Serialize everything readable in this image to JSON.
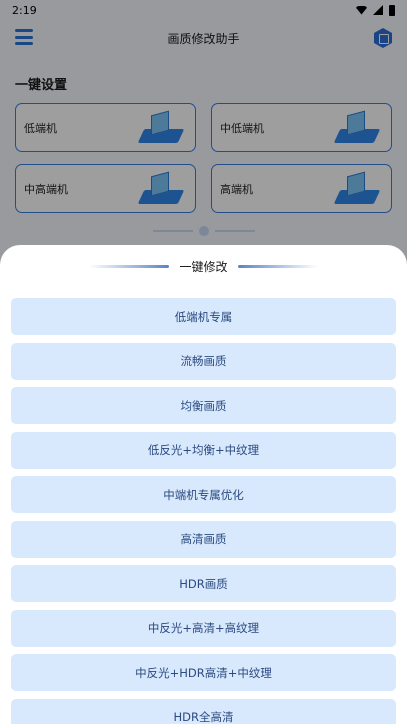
{
  "statusbar": {
    "time": "2:19"
  },
  "appbar": {
    "title": "画质修改助手"
  },
  "section": {
    "title": "一键设置"
  },
  "cards": [
    {
      "label": "低端机"
    },
    {
      "label": "中低端机"
    },
    {
      "label": "中高端机"
    },
    {
      "label": "高端机"
    }
  ],
  "sheet": {
    "title": "一键修改",
    "options": [
      "低端机专属",
      "流畅画质",
      "均衡画质",
      "低反光+均衡+中纹理",
      "中端机专属优化",
      "高清画质",
      "HDR画质",
      "中反光+高清+高纹理",
      "中反光+HDR高清+中纹理",
      "HDR全高清"
    ]
  },
  "colors": {
    "accent": "#2a74d6",
    "option_bg": "#d8e9fd"
  }
}
